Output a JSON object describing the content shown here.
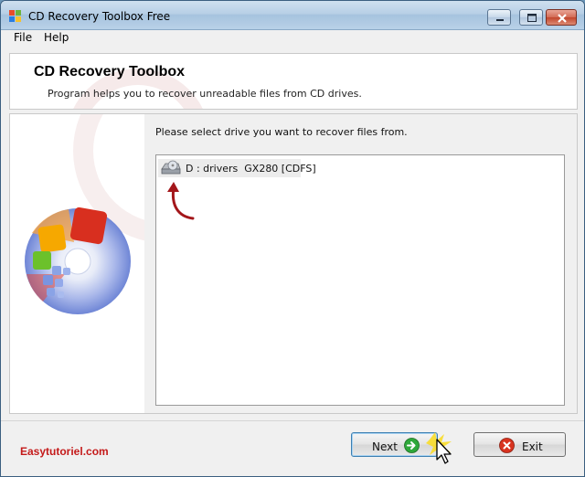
{
  "window": {
    "title": "CD Recovery Toolbox Free",
    "controls": [
      "minimize",
      "maximize",
      "close"
    ]
  },
  "menu": {
    "items": [
      "File",
      "Help"
    ]
  },
  "header": {
    "title": "CD Recovery Toolbox",
    "subtitle": "Program helps you to recover unreadable files from CD drives."
  },
  "main": {
    "prompt": "Please select drive you want to recover files from.",
    "drives": [
      {
        "label": "D : drivers  GX280 [CDFS]",
        "icon": "cd-drive-icon",
        "selected": true
      }
    ]
  },
  "footer": {
    "watermark": "Easytutoriel.com",
    "next_label": "Next",
    "exit_label": "Exit"
  },
  "colors": {
    "accent_red": "#c41a1a",
    "next_icon": "#2fa83a",
    "exit_icon": "#d8331f"
  }
}
